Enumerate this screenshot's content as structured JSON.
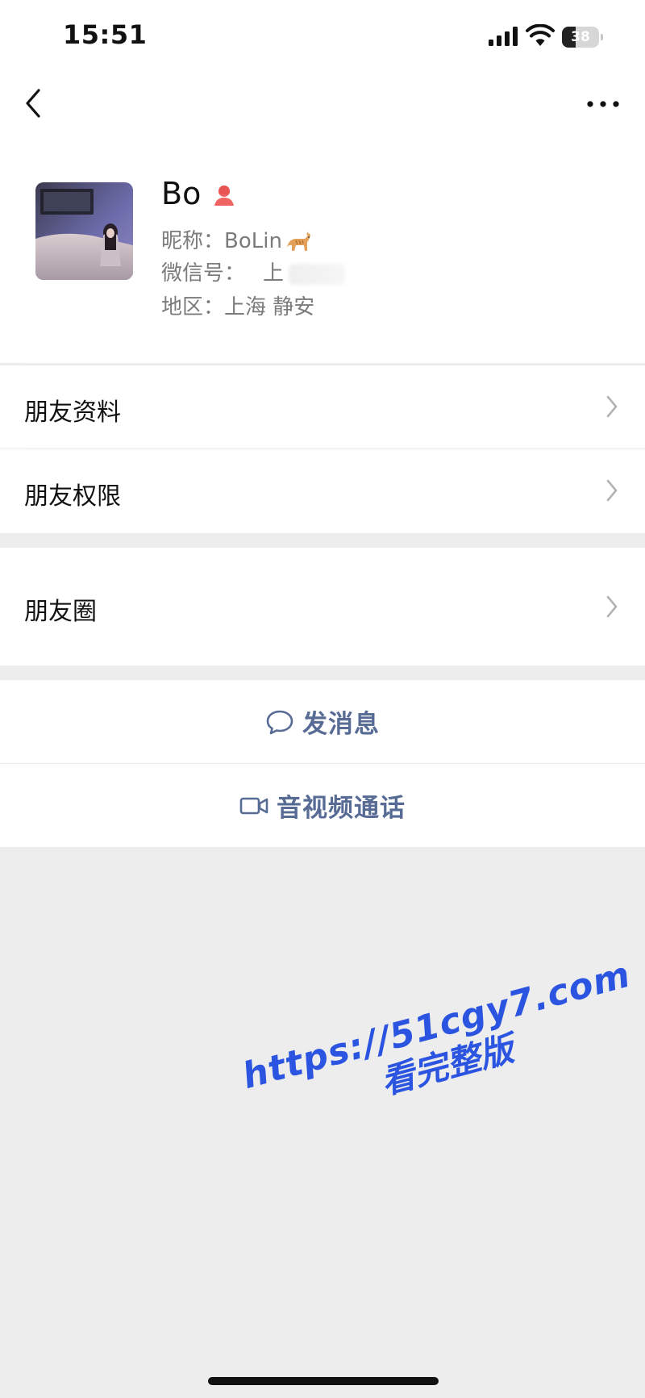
{
  "status_bar": {
    "time": "15:51",
    "battery": "38",
    "battery_level": 0.38,
    "signal_icon": "cellular-signal-icon",
    "wifi_icon": "wifi-icon",
    "battery_icon": "battery-icon"
  },
  "nav": {
    "back_icon": "chevron-left-icon",
    "more_icon": "more-dots-icon"
  },
  "profile": {
    "name": "Bo",
    "gender_icon": "female-person-icon",
    "nickname_label": "昵称：",
    "nickname": "BoLin",
    "nickname_emoji_icon": "cat-emoji-icon",
    "wechat_id_label": "微信号：",
    "wechat_id": "上",
    "region_label": "地区：",
    "region": "上海 静安"
  },
  "menu": {
    "items": [
      {
        "label": "朋友资料"
      },
      {
        "label": "朋友权限"
      },
      {
        "label": "朋友圈"
      }
    ]
  },
  "actions": {
    "message": {
      "label": "发消息",
      "icon": "chat-bubble-icon"
    },
    "call": {
      "label": "音视频通话",
      "icon": "video-camera-icon"
    }
  },
  "watermark": {
    "line1": "https://51cgy7.com",
    "line2": "看完整版"
  },
  "colors": {
    "background": "#ededed",
    "surface": "#ffffff",
    "link": "#576b95",
    "watermark": "#2b55e0",
    "female_icon": "#f06464"
  }
}
